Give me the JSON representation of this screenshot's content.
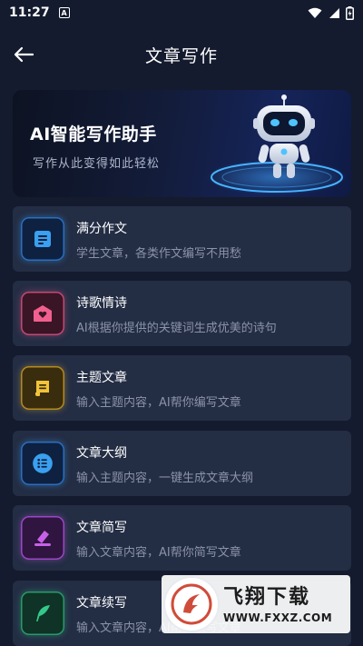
{
  "status_bar": {
    "time": "11:27",
    "notif_glyph": "A"
  },
  "nav": {
    "title": "文章写作",
    "back_icon": "arrow-left-icon"
  },
  "banner": {
    "title": "AI智能写作助手",
    "subtitle": "写作从此变得如此轻松"
  },
  "items": [
    {
      "title": "满分作文",
      "desc": "学生文章，各类作文编写不用愁",
      "icon": "document-icon",
      "color": "#3aa0f0"
    },
    {
      "title": "诗歌情诗",
      "desc": "AI根据你提供的关键词生成优美的诗句",
      "icon": "envelope-heart-icon",
      "color": "#f0608e"
    },
    {
      "title": "主题文章",
      "desc": "输入主题内容，AI帮你编写文章",
      "icon": "scroll-icon",
      "color": "#f2c33a"
    },
    {
      "title": "文章大纲",
      "desc": "输入主题内容，一键生成文章大纲",
      "icon": "list-icon",
      "color": "#3aa0f0"
    },
    {
      "title": "文章简写",
      "desc": "输入文章内容，AI帮你简写文章",
      "icon": "eraser-icon",
      "color": "#c860e8"
    },
    {
      "title": "文章续写",
      "desc": "输入文章内容，AI帮你续写文章",
      "icon": "feather-icon",
      "color": "#34c88a"
    }
  ],
  "watermark": {
    "name": "飞翔下载",
    "url": "WWW.FXXZ.COM"
  }
}
